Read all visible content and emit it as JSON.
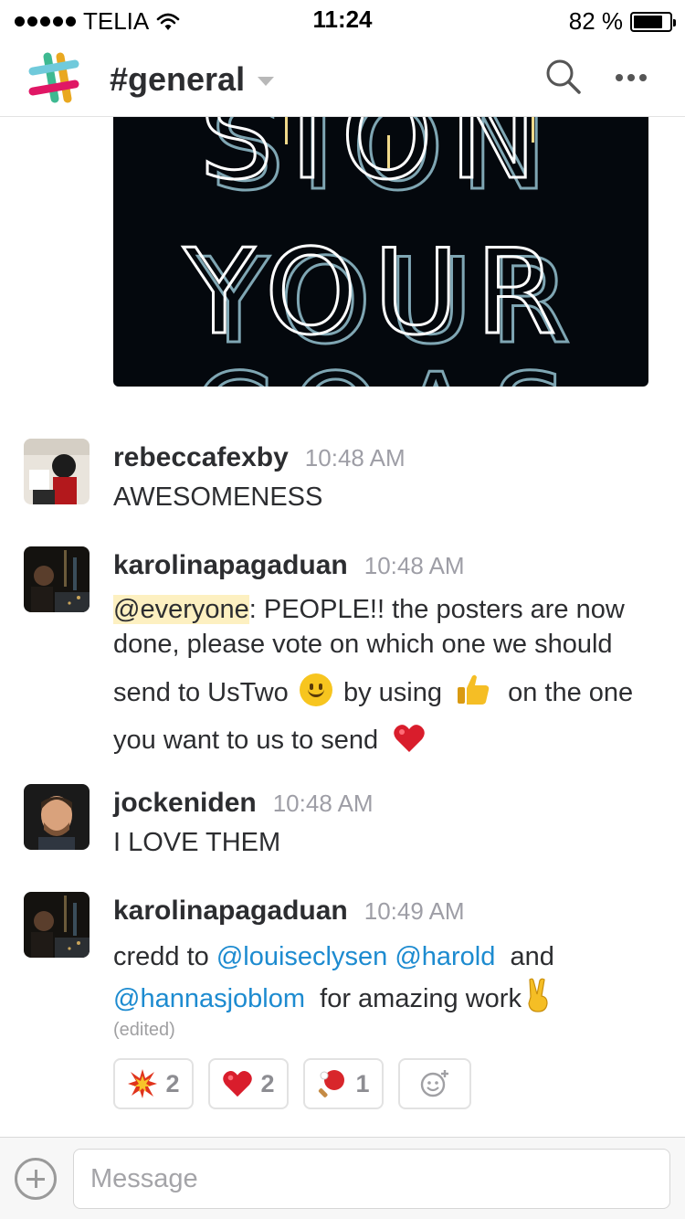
{
  "status_bar": {
    "carrier": "TELIA",
    "time": "11:24",
    "battery_text": "82 %",
    "battery_level": 0.82
  },
  "header": {
    "channel": "#general"
  },
  "poster": {
    "line_1": "SION",
    "line_2": "YOUR",
    "line_3": "COAS"
  },
  "messages": [
    {
      "user": "rebeccafexby",
      "time": "10:48 AM",
      "lines": [
        "AWESOMENESS"
      ]
    },
    {
      "user": "karolinapagaduan",
      "time": "10:48 AM",
      "mention": "@everyone",
      "line_1_rest": ": PEOPLE!! the posters are now",
      "line_2": "done, please vote on which one we should",
      "line_3a": "send to UsTwo",
      "line_3b": "by using",
      "line_3c": "on the one",
      "line_4": "you want to us to send"
    },
    {
      "user": "jockeniden",
      "time": "10:48 AM",
      "lines": [
        "I LOVE THEM"
      ]
    },
    {
      "user": "karolinapagaduan",
      "time": "10:49 AM",
      "text_a": "credd to ",
      "mention_1": "@louiseclysen",
      "mention_2": "@harold",
      "text_b": "and",
      "mention_3": "@hannasjoblom",
      "text_c": "for amazing work",
      "edited": "(edited)"
    }
  ],
  "reactions": [
    {
      "icon": "collision-icon",
      "count": "2"
    },
    {
      "icon": "heart-icon",
      "count": "2"
    },
    {
      "icon": "ping-pong-icon",
      "count": "1"
    }
  ],
  "composer": {
    "placeholder": "Message"
  },
  "colors": {
    "mention_link": "#1d8bd0",
    "mention_highlight": "#fdf0c1",
    "timestamp": "#9e9ea6"
  }
}
